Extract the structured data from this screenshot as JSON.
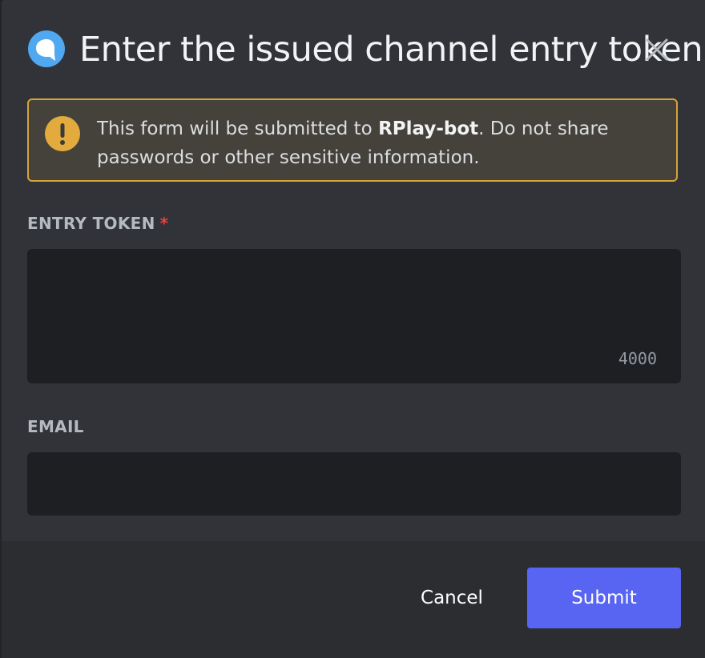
{
  "modal": {
    "title": "Enter the issued channel entry token",
    "icon": "chat-bubble-icon",
    "close_icon": "close-icon"
  },
  "notice": {
    "icon": "warning-icon",
    "text_before": "This form will be submitted to ",
    "bot_name": "RPlay-bot",
    "text_after": ". Do not share passwords or other sensitive information.",
    "accent_color": "#d6a23a"
  },
  "fields": {
    "entry_token": {
      "label": "ENTRY TOKEN",
      "required_marker": "*",
      "value": "",
      "char_limit": "4000"
    },
    "email": {
      "label": "EMAIL",
      "value": ""
    }
  },
  "footer": {
    "cancel_label": "Cancel",
    "submit_label": "Submit",
    "submit_color": "#5865f2"
  }
}
